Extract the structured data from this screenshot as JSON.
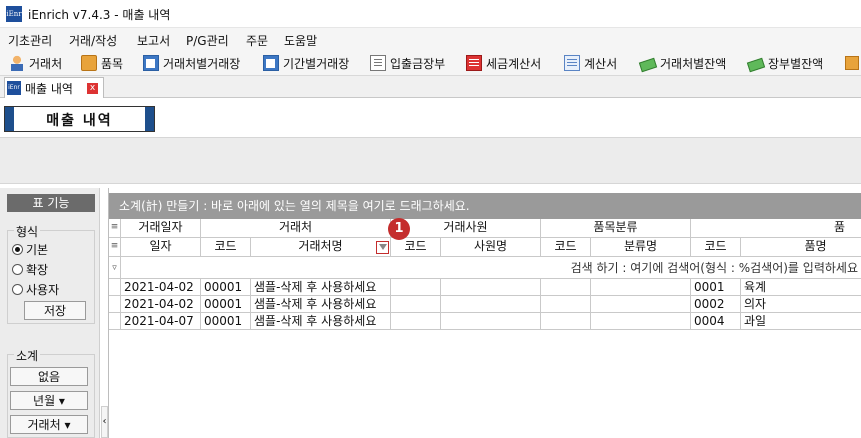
{
  "window": {
    "title": "iEnrich v7.4.3 - 매출 내역",
    "logo_text": "iEnr"
  },
  "menu": [
    "기초관리",
    "거래/작성",
    "보고서",
    "P/G관리",
    "주문",
    "도움말"
  ],
  "toolbar": [
    {
      "label": "거래처",
      "icon": "person-icon"
    },
    {
      "label": "품목",
      "icon": "box-icon"
    },
    {
      "label": "거래처별거래장",
      "icon": "ledger-icon"
    },
    {
      "label": "기간별거래장",
      "icon": "ledger-icon"
    },
    {
      "label": "입출금장부",
      "icon": "book-icon"
    },
    {
      "label": "세금계산서",
      "icon": "invoice-icon"
    },
    {
      "label": "계산서",
      "icon": "bill-icon"
    },
    {
      "label": "거래처별잔액",
      "icon": "cash-icon"
    },
    {
      "label": "장부별잔액",
      "icon": "cash-icon"
    }
  ],
  "tab": {
    "label": "매출 내역",
    "close": "x"
  },
  "page_title": "매출 내역",
  "side": {
    "header": "표 기능",
    "format_group": "형식",
    "options": [
      {
        "label": "기본",
        "selected": true
      },
      {
        "label": "확장",
        "selected": false
      },
      {
        "label": "사용자",
        "selected": false
      }
    ],
    "save": "저장",
    "subtotal_group": "소계",
    "none": "없음",
    "year_month": "년월 ▾",
    "customer": "거래처 ▾"
  },
  "grid": {
    "group_hint": "소계(計) 만들기 : 바로 아래에 있는 열의 제목을 여기로 드래그하세요.",
    "group_headers": [
      "거래일자",
      "거래처",
      "거래사원",
      "품목분류",
      "품"
    ],
    "columns": [
      "일자",
      "코드",
      "거래처명",
      "코드",
      "사원명",
      "코드",
      "분류명",
      "코드",
      "품명"
    ],
    "filter_hint": "검색 하기 : 여기에 검색어(형식 : %검색어)를 입력하세요",
    "badge": "1",
    "rows": [
      [
        "2021-04-02",
        "00001",
        "샘플-삭제 후 사용하세요",
        "",
        "",
        "",
        "",
        "0001",
        "육계"
      ],
      [
        "2021-04-02",
        "00001",
        "샘플-삭제 후 사용하세요",
        "",
        "",
        "",
        "",
        "0002",
        "의자"
      ],
      [
        "2021-04-07",
        "00001",
        "샘플-삭제 후 사용하세요",
        "",
        "",
        "",
        "",
        "0004",
        "과일"
      ]
    ]
  }
}
